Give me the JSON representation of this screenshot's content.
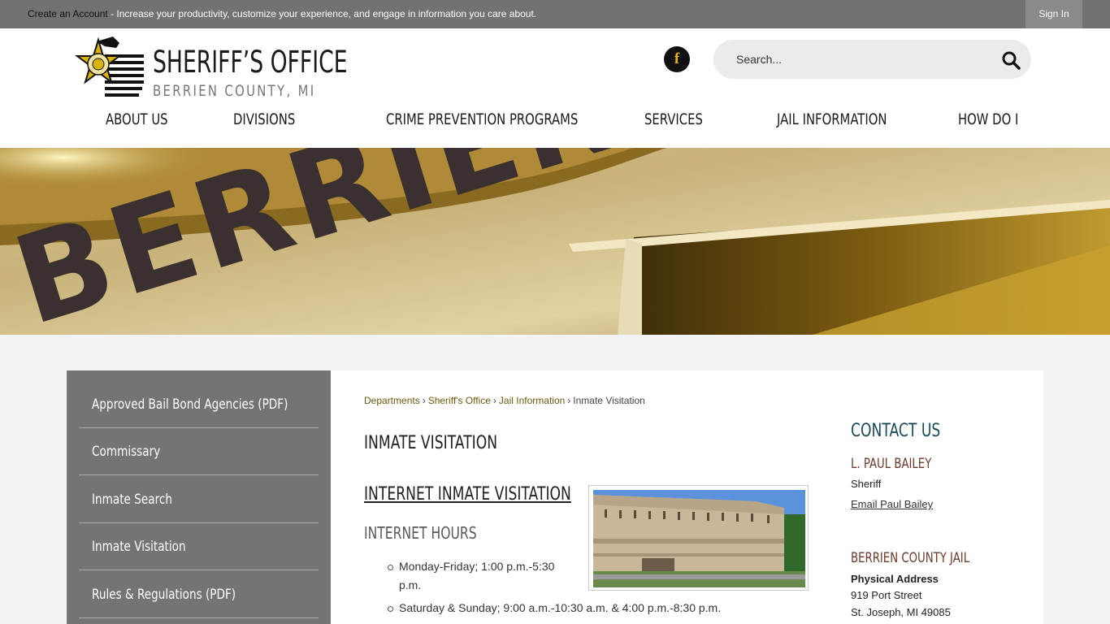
{
  "topbar": {
    "create_account": "Create an Account",
    "message": " - Increase your productivity, customize your experience, and engage in information you care about.",
    "sign_in": "Sign In"
  },
  "header": {
    "logo_title": "SHERIFF’S OFFICE",
    "logo_subtitle": "BERRIEN COUNTY, MI",
    "facebook_glyph": "f",
    "search_placeholder": "Search..."
  },
  "nav": {
    "items": [
      "ABOUT US",
      "DIVISIONS",
      "CRIME PREVENTION PROGRAMS",
      "SERVICES",
      "JAIL INFORMATION",
      "HOW DO I"
    ]
  },
  "hero": {
    "badge_text": "BERRIEN"
  },
  "sidebar": {
    "items": [
      "Approved Bail Bond Agencies (PDF)",
      "Commissary",
      "Inmate Search",
      "Inmate Visitation",
      "Rules & Regulations (PDF)"
    ]
  },
  "breadcrumb": {
    "items": [
      "Departments",
      "Sheriff's Office",
      "Jail Information"
    ],
    "current": "Inmate Visitation",
    "separator": "›"
  },
  "content": {
    "page_title": "INMATE VISITATION",
    "section_link": "INTERNET INMATE VISITATION",
    "subheading": "INTERNET HOURS",
    "hours": [
      "Monday-Friday; 1:00 p.m.-5:30 p.m.",
      "Saturday & Sunday; 9:00 a.m.-10:30 a.m. & 4:00 p.m.-8:30 p.m."
    ]
  },
  "contact": {
    "title": "CONTACT US",
    "name": "L. PAUL BAILEY",
    "role": "Sheriff",
    "email_link": "Email Paul Bailey",
    "facility": "BERRIEN COUNTY JAIL",
    "address_label": "Physical Address",
    "street": "919 Port Street",
    "city": "St. Joseph, MI 49085"
  },
  "colors": {
    "topbar_bg": "#727272",
    "sidebar_bg": "#747474",
    "link_gold": "#6b5a10",
    "contact_title": "#1c4a5a",
    "contact_heading": "#6a3a2a",
    "facebook_yellow": "#e6b200"
  },
  "icons": [
    "facebook-icon",
    "search-icon",
    "sheriff-badge-logo"
  ]
}
